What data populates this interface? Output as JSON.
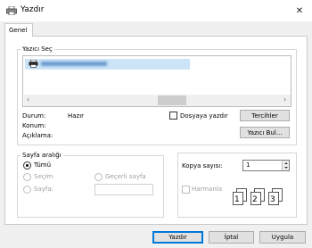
{
  "window": {
    "title": "Yazdır",
    "close": "✕"
  },
  "tabs": [
    {
      "label": "Genel"
    }
  ],
  "select_printer": {
    "label": "Yazıcı Seç",
    "status_label": "Durum:",
    "status_value": "Hazır",
    "location_label": "Konum:",
    "comment_label": "Açıklama:",
    "print_to_file_label": "Dosyaya yazdır",
    "print_to_file_checked": false,
    "preferences_button": "Tercihler",
    "find_printer_button": "Yazıcı Bul...",
    "scroll_left": "‹",
    "scroll_right": "›"
  },
  "page_range": {
    "label": "Sayfa aralığı",
    "all_label": "Tümü",
    "selection_label": "Seçim",
    "current_page_label": "Geçerli sayfa",
    "pages_label": "Sayfa:",
    "selected": "all",
    "pages_value": ""
  },
  "copies": {
    "count_label": "Kopya sayısı:",
    "count_value": "1",
    "collate_label": "Harmanla",
    "collate_checked": false,
    "collate_pages": [
      "1",
      "1",
      "2",
      "2",
      "3",
      "3"
    ]
  },
  "footer": {
    "print_button": "Yazdır",
    "cancel_button": "İptal",
    "apply_button": "Uygula"
  },
  "colors": {
    "accent": "#0078d7",
    "selection": "#cce4f7"
  }
}
